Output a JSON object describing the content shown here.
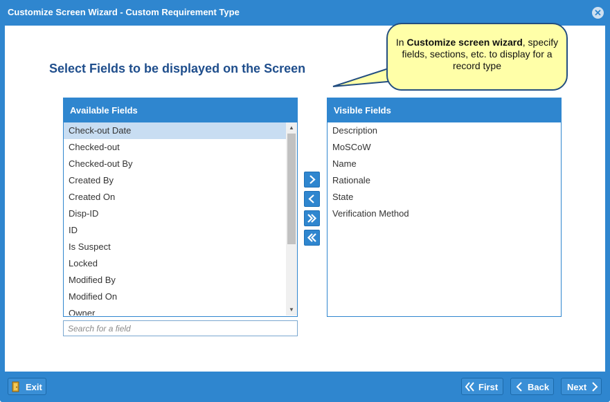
{
  "window": {
    "title": "Customize Screen Wizard - Custom Requirement Type",
    "close_icon": "close-circle-icon"
  },
  "main": {
    "heading": "Select Fields to be displayed on the Screen"
  },
  "callout": {
    "prefix": "In ",
    "bold": "Customize screen wizard",
    "suffix": ", specify fields, sections, etc. to display for a record type",
    "background": "#ffffa8",
    "border": "#234e80"
  },
  "available_fields": {
    "header": "Available Fields",
    "items": [
      "Check-out Date",
      "Checked-out",
      "Checked-out By",
      "Created By",
      "Created On",
      "Disp-ID",
      "ID",
      "Is Suspect",
      "Locked",
      "Modified By",
      "Modified On",
      "Owner"
    ],
    "selected": "Check-out Date"
  },
  "visible_fields": {
    "header": "Visible Fields",
    "items": [
      "Description",
      "MoSCoW",
      "Name",
      "Rationale",
      "State",
      "Verification Method"
    ]
  },
  "search": {
    "placeholder": "Search for a field",
    "value": ""
  },
  "move_buttons": {
    "add": "chevron-right-icon",
    "remove": "chevron-left-icon",
    "add_all": "double-chevron-right-icon",
    "remove_all": "double-chevron-left-icon"
  },
  "footer": {
    "exit_label": "Exit",
    "first_label": "First",
    "back_label": "Back",
    "next_label": "Next"
  },
  "colors": {
    "accent": "#2f86cf",
    "heading": "#1f4e8c",
    "selection": "#c8ddf2"
  }
}
